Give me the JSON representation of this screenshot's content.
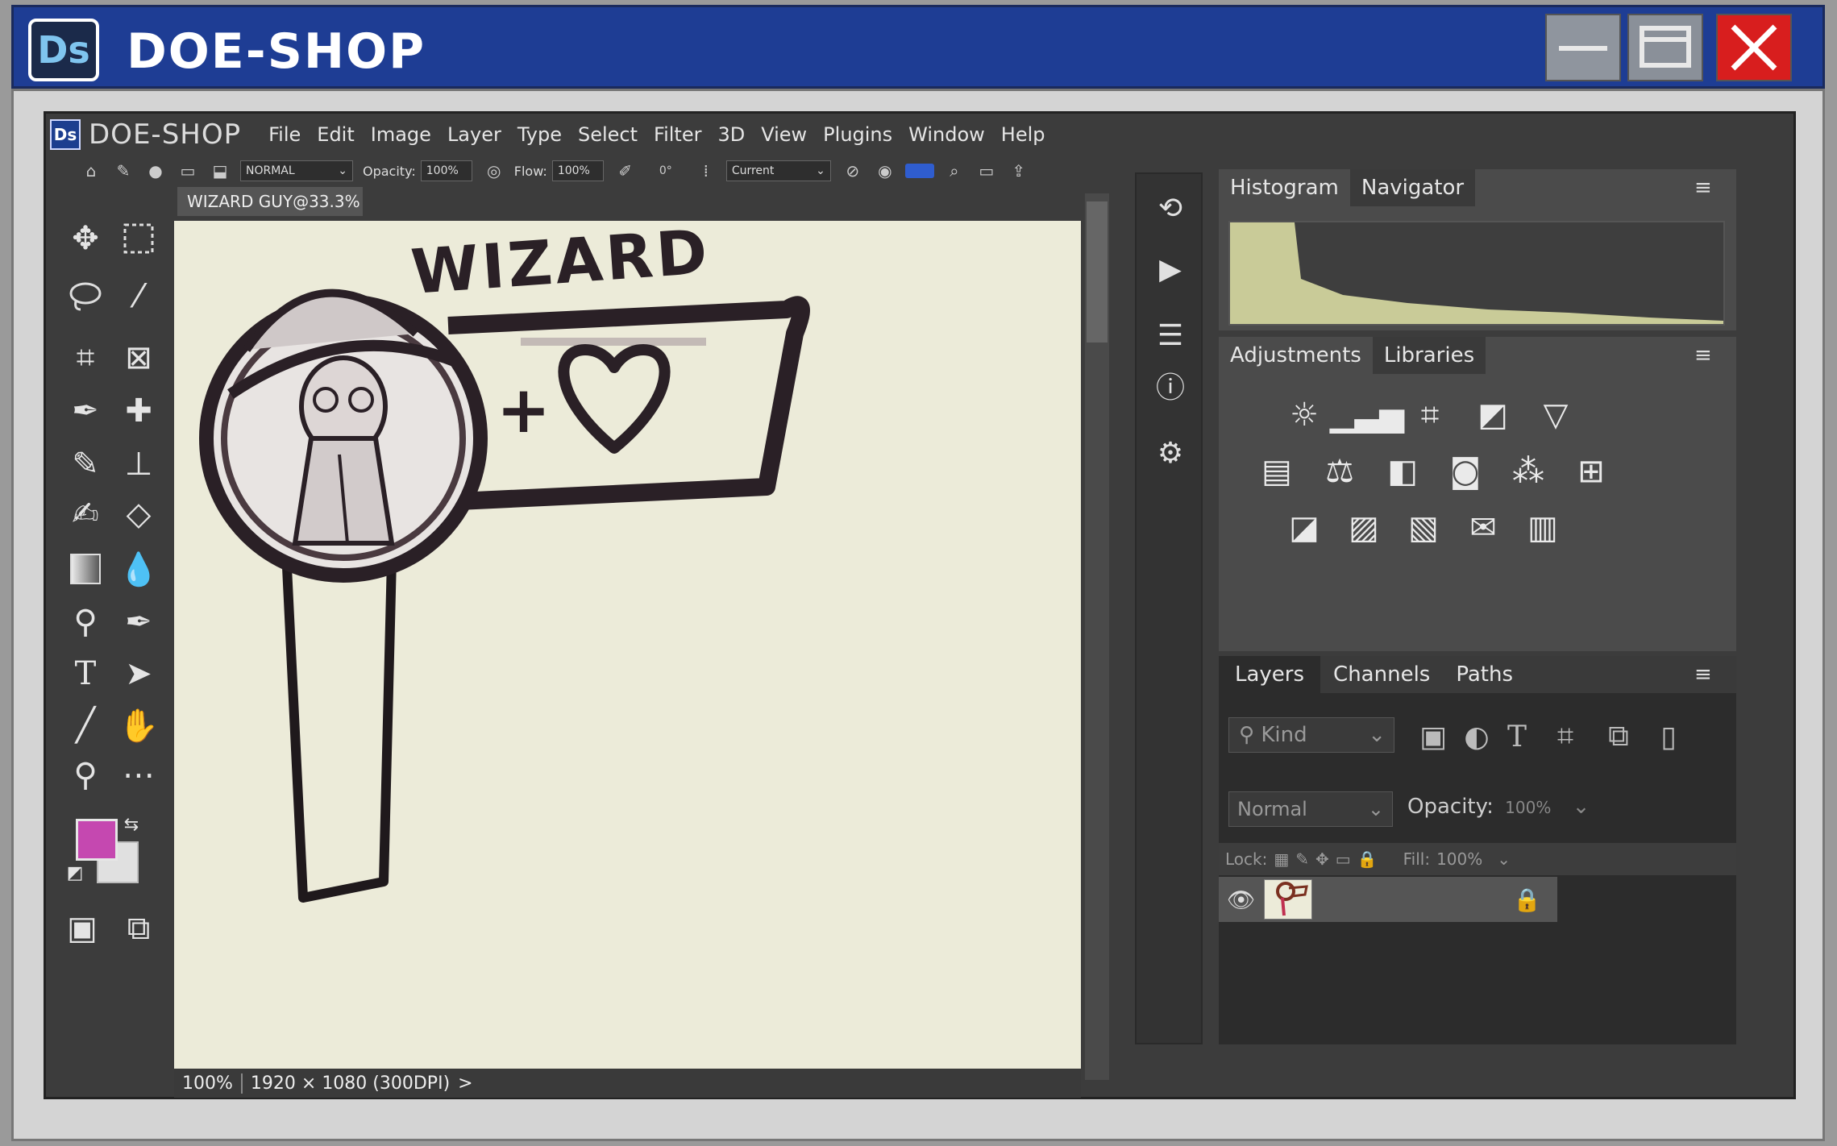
{
  "window": {
    "title": "DOE-SHOP",
    "logo_text": "Ds",
    "minimize_label": "—",
    "restore_label": "❐",
    "close_label": "✕"
  },
  "app": {
    "logo_text": "Ds",
    "title": "DOE-SHOP"
  },
  "menubar": {
    "items": [
      "File",
      "Edit",
      "Image",
      "Layer",
      "Type",
      "Select",
      "Filter",
      "3D",
      "View",
      "Plugins",
      "Window",
      "Help"
    ]
  },
  "options_bar": {
    "mode": "NORMAL",
    "opacity_label": "Opacity:",
    "opacity_value": "100%",
    "flow_label": "Flow:",
    "flow_value": "100%",
    "angle_value": "0°",
    "sample": "Current"
  },
  "document": {
    "tab_title": "WIZARD GUY@33.3%",
    "canvas_text": "WIZARD",
    "canvas_plus": "+",
    "status_zoom": "100%",
    "status_info": "1920 × 1080 (300DPI)",
    "status_arrow": ">"
  },
  "colors": {
    "foreground": "#c548b0",
    "background": "#e0e0e0",
    "title_bar": "#1e3d94",
    "close_button": "#d81e1e",
    "canvas": "#ecebd9",
    "histogram": "#c9cb98"
  },
  "panels": {
    "top_tabs": [
      "Histogram",
      "Navigator"
    ],
    "mid_tabs": [
      "Adjustments",
      "Libraries"
    ],
    "layers_tabs": [
      "Layers",
      "Channels",
      "Paths"
    ],
    "menu_icon": "≡"
  },
  "layers": {
    "kind_placeholder": "Kind",
    "blend_mode": "Normal",
    "opacity_label": "Opacity:",
    "opacity_value": "100%",
    "lock_label": "Lock:",
    "fill_label": "Fill:",
    "fill_value": "100%"
  }
}
